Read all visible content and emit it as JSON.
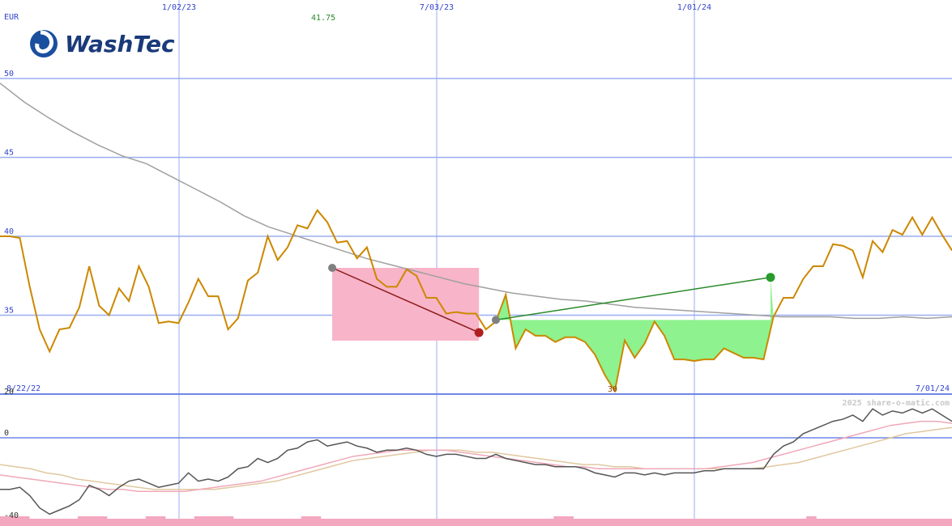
{
  "logo": {
    "text": "WashTec"
  },
  "watermark": "2025 share-o-matic.com",
  "chart_data": [
    {
      "type": "line",
      "currency_label": "EUR",
      "x_tick_labels": [
        "1/02/23",
        "7/03/23",
        "1/01/24"
      ],
      "x_start_label": "8/22/22",
      "x_end_label": "7/01/24",
      "y_ticks": [
        50,
        45,
        40,
        35
      ],
      "y_range": [
        30,
        50
      ],
      "high_label": "41.75",
      "low_label": "30",
      "grid": true,
      "series": [
        {
          "color": "#cc8800",
          "values": [
            40.0,
            40.0,
            39.9,
            36.8,
            34.1,
            32.7,
            34.1,
            34.2,
            35.5,
            38.1,
            35.6,
            35.0,
            36.7,
            35.9,
            38.1,
            36.8,
            34.5,
            34.6,
            34.5,
            35.8,
            37.3,
            36.2,
            36.2,
            34.1,
            34.8,
            37.2,
            37.7,
            40.0,
            38.5,
            39.3,
            40.7,
            40.5,
            41.65,
            40.9,
            39.6,
            39.7,
            38.6,
            39.3,
            37.3,
            36.8,
            36.8,
            37.9,
            37.5,
            36.1,
            36.1,
            35.1,
            35.2,
            35.1,
            35.1,
            34.1,
            34.6,
            36.3,
            32.9,
            34.1,
            33.7,
            33.7,
            33.3,
            33.6,
            33.6,
            33.3,
            32.5,
            31.2,
            30.2,
            33.4,
            32.3,
            33.2,
            34.6,
            33.7,
            32.2,
            32.2,
            32.1,
            32.2,
            32.2,
            32.9,
            32.6,
            32.3,
            32.3,
            32.2,
            34.9,
            36.1,
            36.1,
            37.3,
            38.1,
            38.1,
            39.5,
            39.4,
            39.1,
            37.4,
            39.7,
            39.0,
            40.4,
            40.1,
            41.2,
            40.1,
            41.2,
            40.1,
            39.1
          ]
        },
        {
          "color": "#a0a0a0",
          "values": [
            49.7,
            48.5,
            47.5,
            46.6,
            45.8,
            45.1,
            44.6,
            43.8,
            43.0,
            42.2,
            41.3,
            40.6,
            40.1,
            39.6,
            39.1,
            38.6,
            38.2,
            37.8,
            37.4,
            37.0,
            36.7,
            36.4,
            36.2,
            36.0,
            35.9,
            35.7,
            35.5,
            35.4,
            35.3,
            35.2,
            35.1,
            35.0,
            34.9,
            34.9,
            34.9,
            34.8,
            34.8,
            34.9,
            34.8,
            34.9
          ]
        }
      ],
      "signals": [
        {
          "kind": "down",
          "from": [
            33.5,
            38.0
          ],
          "to": [
            48.3,
            33.9
          ]
        },
        {
          "kind": "up",
          "from": [
            50.0,
            34.7
          ],
          "to": [
            77.7,
            37.4
          ]
        },
        {
          "kind": "down",
          "from": [
            134.3,
            33.5
          ],
          "to": [
            136.8,
            32.1
          ]
        },
        {
          "kind": "down",
          "from": [
            149.6,
            32.5
          ],
          "to": [
            153.5,
            32.1
          ]
        },
        {
          "kind": "up",
          "from": [
            157.4,
            34.8
          ],
          "to": [
            194.3,
            39.1
          ]
        }
      ]
    },
    {
      "type": "line",
      "y_ticks": [
        20,
        0,
        -40
      ],
      "y_range": [
        -40,
        20
      ],
      "series": [
        {
          "color": "#555555",
          "values": [
            -25,
            -25,
            -24,
            -28,
            -34,
            -37,
            -35,
            -33,
            -30,
            -23,
            -25,
            -28,
            -24,
            -21,
            -20,
            -22,
            -24,
            -23,
            -22,
            -17,
            -21,
            -20,
            -21,
            -19,
            -15,
            -14,
            -10,
            -12,
            -10,
            -6,
            -5,
            -2,
            -1,
            -4,
            -3,
            -2,
            -4,
            -5,
            -7,
            -6,
            -6,
            -5,
            -6,
            -8,
            -9,
            -8,
            -8,
            -9,
            -10,
            -10,
            -8,
            -10,
            -11,
            -12,
            -13,
            -13,
            -14,
            -14,
            -14,
            -15,
            -17,
            -18,
            -19,
            -17,
            -17,
            -18,
            -17,
            -18,
            -17,
            -17,
            -17,
            -16,
            -16,
            -15,
            -15,
            -15,
            -15,
            -15,
            -8,
            -4,
            -2,
            2,
            4,
            6,
            8,
            9,
            11,
            8,
            14,
            11,
            13,
            12,
            14,
            12,
            14,
            11,
            8
          ]
        },
        {
          "color": "#f0a8b8",
          "values": [
            -18,
            -19,
            -20,
            -21,
            -22,
            -23,
            -24,
            -25,
            -25,
            -26,
            -26,
            -26,
            -26,
            -25,
            -24,
            -23,
            -22,
            -21,
            -19,
            -17,
            -15,
            -13,
            -11,
            -9,
            -8,
            -7,
            -6,
            -6,
            -6,
            -6,
            -7,
            -8,
            -9,
            -10,
            -11,
            -12,
            -13,
            -14,
            -14,
            -15,
            -15,
            -15,
            -15,
            -15,
            -15,
            -15,
            -15,
            -14,
            -13,
            -12,
            -10,
            -8,
            -6,
            -4,
            -2,
            0,
            2,
            4,
            6,
            7,
            8,
            8,
            7
          ]
        },
        {
          "color": "#e0c8a0",
          "values": [
            -13,
            -14,
            -15,
            -17,
            -18,
            -20,
            -21,
            -22,
            -23,
            -24,
            -25,
            -25,
            -25,
            -25,
            -25,
            -24,
            -23,
            -22,
            -21,
            -19,
            -17,
            -15,
            -13,
            -11,
            -10,
            -9,
            -8,
            -7,
            -6,
            -6,
            -6,
            -7,
            -7,
            -8,
            -9,
            -10,
            -11,
            -12,
            -13,
            -13,
            -14,
            -14,
            -15,
            -15,
            -15,
            -15,
            -15,
            -15,
            -15,
            -15,
            -14,
            -13,
            -12,
            -10,
            -8,
            -6,
            -4,
            -2,
            0,
            2,
            3,
            4,
            5
          ]
        }
      ],
      "volume": [
        4,
        4,
        4,
        3,
        3,
        3,
        3,
        3,
        4,
        4,
        4,
        3,
        3,
        3,
        3,
        4,
        4,
        3,
        3,
        3,
        4,
        4,
        4,
        4,
        3,
        3,
        3,
        3,
        3,
        3,
        3,
        4,
        4,
        3,
        3,
        3,
        3,
        3,
        3,
        3,
        3,
        3,
        3,
        3,
        3,
        3,
        3,
        3,
        3,
        3,
        3,
        3,
        3,
        3,
        3,
        3,
        3,
        4,
        4,
        3,
        3,
        3,
        3,
        3,
        3,
        3,
        3,
        3,
        3,
        3,
        3,
        3,
        3,
        3,
        3,
        3,
        3,
        3,
        3,
        3,
        3,
        3,
        3,
        4,
        3,
        3,
        3,
        3,
        3,
        3,
        3,
        3,
        3,
        3,
        3,
        3,
        3,
        3
      ]
    }
  ]
}
